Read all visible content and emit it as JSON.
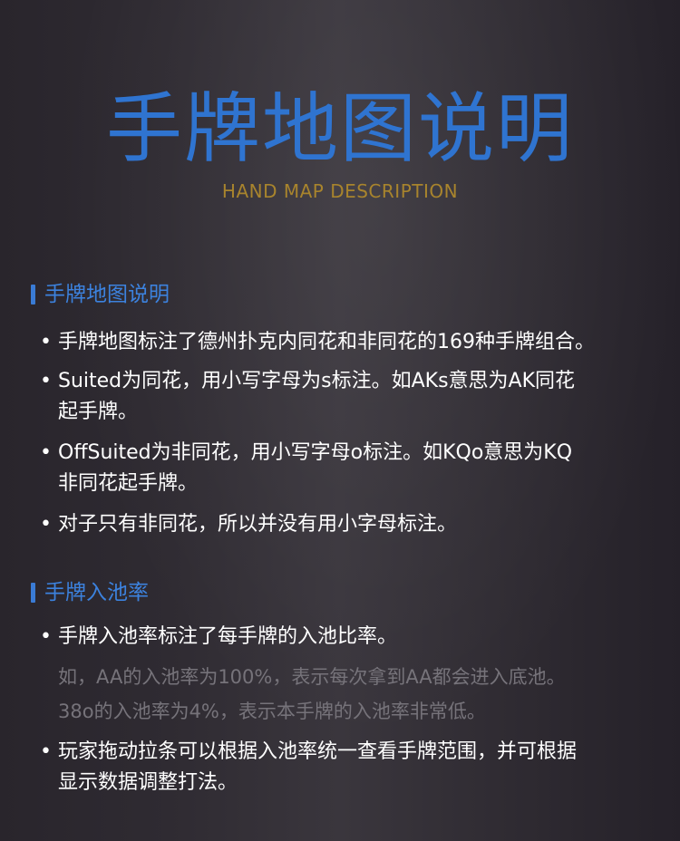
{
  "header": {
    "title": "手牌地图说明",
    "subtitle": "HAND MAP DESCRIPTION"
  },
  "section1": {
    "title": "手牌地图说明",
    "bullets": [
      {
        "lines": [
          "手牌地图标注了德州扑克内同花和非同花的169种手牌组合。"
        ]
      },
      {
        "lines": [
          "Suited为同花，用小写字母为s标注。如AKs意思为AK同花",
          "起手牌。"
        ]
      },
      {
        "lines": [
          "OffSuited为非同花，用小写字母o标注。如KQo意思为KQ",
          "非同花起手牌。"
        ]
      },
      {
        "lines": [
          "对子只有非同花，所以并没有用小字母标注。"
        ]
      }
    ]
  },
  "section2": {
    "title": "手牌入池率",
    "bullets": [
      {
        "lines": [
          "手牌入池率标注了每手牌的入池比率。"
        ]
      },
      {
        "lines": [
          "玩家拖动拉条可以根据入池率统一查看手牌范围，并可根据",
          "显示数据调整打法。"
        ]
      }
    ],
    "note_lines": [
      "如，AA的入池率为100%，表示每次拿到AA都会进入底池。",
      "38o的入池率为4%，表示本手牌的入池率非常低。"
    ]
  },
  "bullet_symbol": "•",
  "colors": {
    "title_blue": "#2f74d0",
    "subtitle_gold": "#a8842d",
    "section_blue": "#3c82de",
    "note_gray": "#76737a"
  }
}
